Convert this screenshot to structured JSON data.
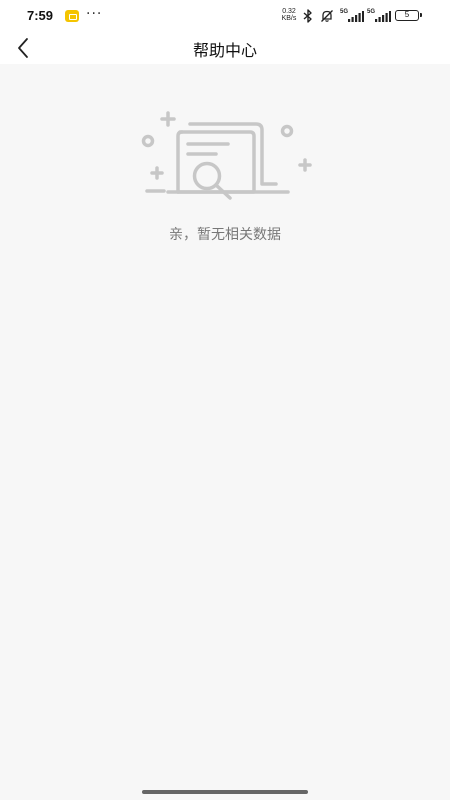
{
  "status_bar": {
    "time": "7:59",
    "more": "···",
    "net_speed_value": "0.32",
    "net_speed_unit": "KB/s",
    "sim1_label": "5G",
    "sim2_label": "5G",
    "battery": "5"
  },
  "nav": {
    "title": "帮助中心",
    "back_icon": "chevron-left-icon"
  },
  "empty_state": {
    "message": "亲，暂无相关数据",
    "icon": "empty-document-search-icon"
  }
}
